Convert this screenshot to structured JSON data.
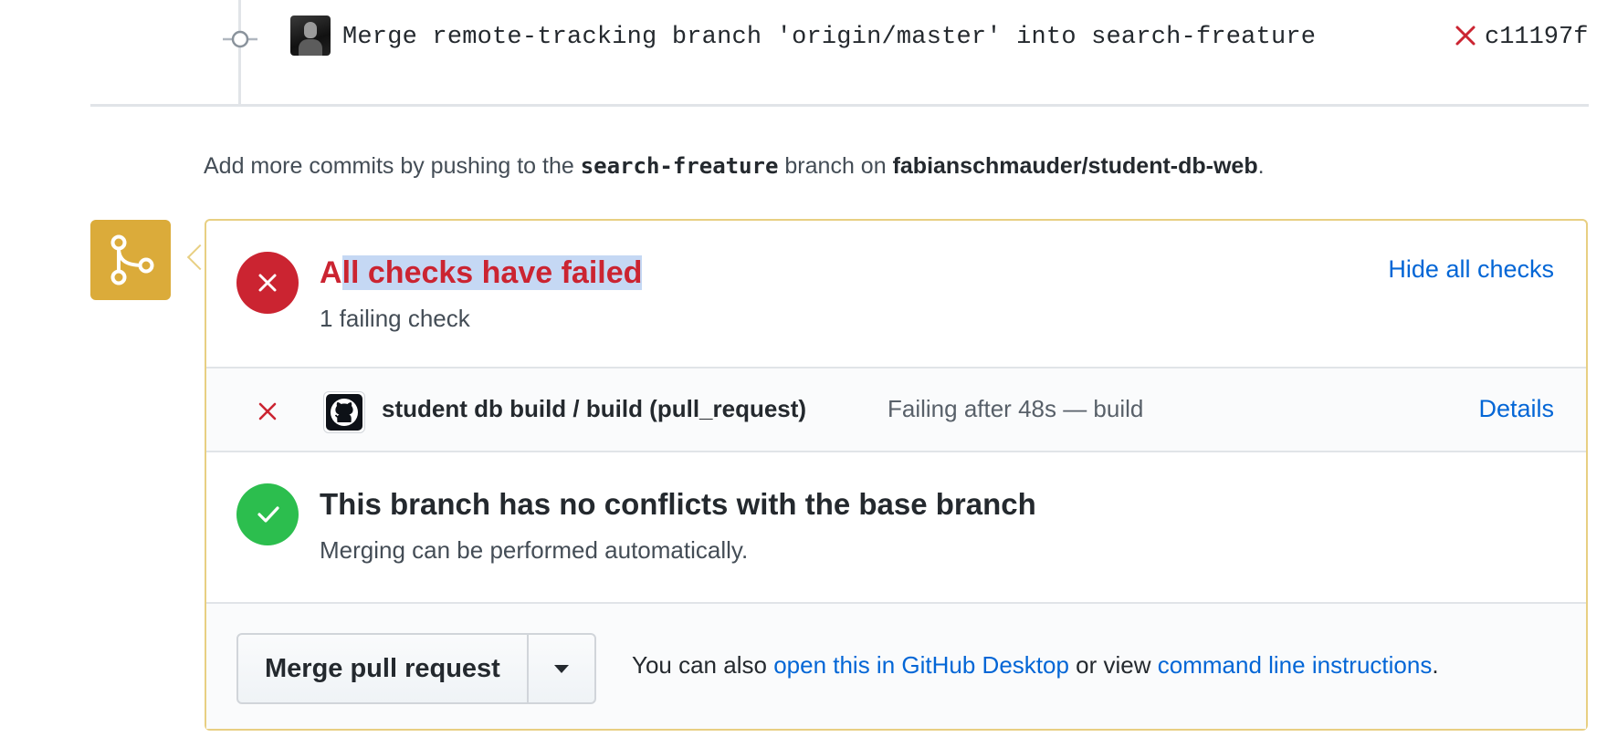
{
  "commit": {
    "message": "Merge remote-tracking branch 'origin/master' into search-freature",
    "sha": "c11197f",
    "status_icon": "x-icon",
    "status_color": "#cb2431"
  },
  "push_hint": {
    "prefix": "Add more commits by pushing to the",
    "branch": "search-freature",
    "middle": "branch on",
    "repo": "fabianschmauder/student-db-web",
    "suffix": "."
  },
  "merge_badge": {
    "icon": "git-merge-icon",
    "color": "#dbab3a"
  },
  "checks": {
    "title_lead": "A",
    "title_selected": "ll checks have failed",
    "subtitle": "1 failing check",
    "toggle_label": "Hide all checks",
    "fail_color": "#cb2431",
    "items": [
      {
        "name": "student db build / build (pull_request)",
        "description": "Failing after 48s — build",
        "details_label": "Details",
        "app_icon": "github-icon"
      }
    ]
  },
  "conflicts": {
    "title": "This branch has no conflicts with the base branch",
    "subtitle": "Merging can be performed automatically.",
    "ok_color": "#2cbe4e"
  },
  "merge": {
    "button_label": "Merge pull request",
    "hint_prefix": "You can also",
    "desktop_link": "open this in GitHub Desktop",
    "hint_middle": "or view",
    "cli_link": "command line instructions",
    "hint_suffix": "."
  }
}
